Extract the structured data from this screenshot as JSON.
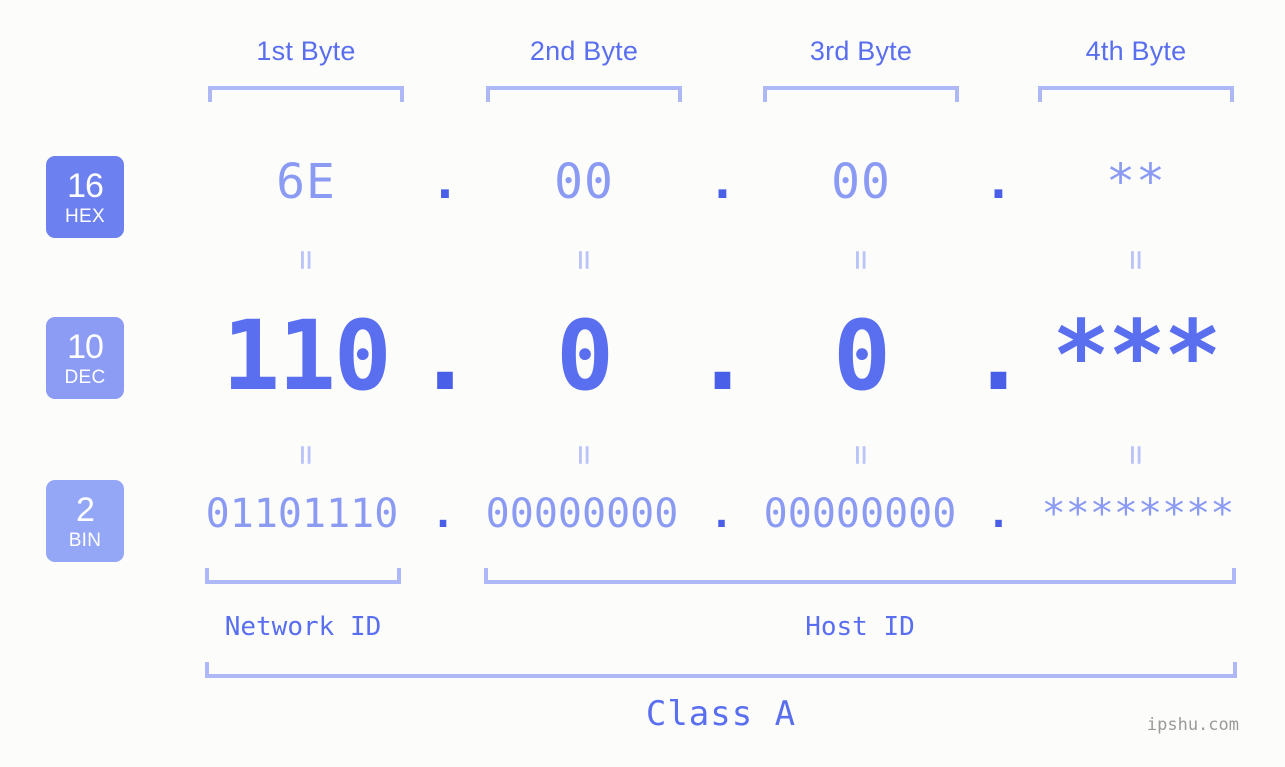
{
  "background_color": "#fcfdfa",
  "accent_color": "#5a6ef0",
  "accent_light_color": "#8b9bf4",
  "bracket_color": "#aeb8f7",
  "dot_color": "#4a5fe8",
  "byte_headers": [
    {
      "label": "1st Byte"
    },
    {
      "label": "2nd Byte"
    },
    {
      "label": "3rd Byte"
    },
    {
      "label": "4th Byte"
    }
  ],
  "bases": [
    {
      "number": "16",
      "name": "HEX",
      "color": "#6d80ef"
    },
    {
      "number": "10",
      "name": "DEC",
      "color": "#8c9bf3"
    },
    {
      "number": "2",
      "name": "BIN",
      "color": "#94a6f6"
    }
  ],
  "rows": {
    "hex": {
      "bytes": [
        "6E",
        "00",
        "00",
        "**"
      ],
      "separator": "."
    },
    "dec": {
      "bytes": [
        "110",
        "0",
        "0",
        "***"
      ],
      "separator": "."
    },
    "bin": {
      "bytes": [
        "01101110",
        "00000000",
        "00000000",
        "********"
      ],
      "separator": "."
    }
  },
  "equals_glyph": "=",
  "id_sections": [
    {
      "label": "Network ID"
    },
    {
      "label": "Host ID"
    }
  ],
  "class_label": "Class A",
  "watermark": "ipshu.com"
}
